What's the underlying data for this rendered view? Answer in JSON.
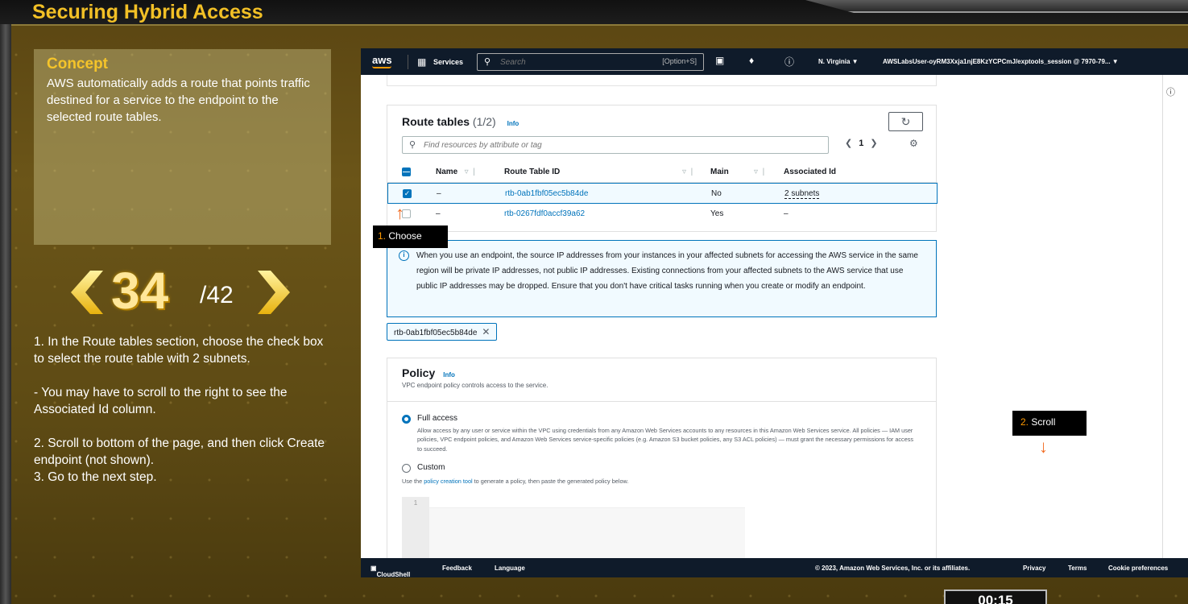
{
  "lesson": {
    "title": "Securing Hybrid Access",
    "concept_title": "Concept",
    "concept_body": "AWS automatically adds a route that points traffic destined for a service to the endpoint to the selected route tables.",
    "step_current": "34",
    "step_total": "/42",
    "instructions": [
      "1. In the Route tables section, choose the check box to select the route table with 2 subnets.",
      "- You may have to scroll to the right to see the Associated Id column.",
      "2. Scroll to bottom of the page, and then click Create endpoint (not shown).",
      "3. Go to the next step."
    ],
    "timer": "00:15"
  },
  "callouts": {
    "choose_num": "1.",
    "choose_text": " Choose",
    "scroll_num": "2.",
    "scroll_text": " Scroll"
  },
  "aws_nav": {
    "logo": "aws",
    "services": "Services",
    "search_placeholder": "Search",
    "search_shortcut": "[Option+S]",
    "region": "N. Virginia ▼",
    "user": "AWSLabsUser-oyRM3Xxja1njE8KzYCPCmJ/exptools_session @ 7970-79... ▼"
  },
  "route_tables": {
    "title": "Route tables",
    "count": "(1/2)",
    "info": "Info",
    "filter_placeholder": "Find resources by attribute or tag",
    "page": "1",
    "columns": [
      "Name",
      "Route Table ID",
      "Main",
      "Associated Id"
    ],
    "rows": [
      {
        "name": "–",
        "id": "rtb-0ab1fbf05ec5b84de",
        "main": "No",
        "assoc": "2 subnets",
        "selected": true
      },
      {
        "name": "–",
        "id": "rtb-0267fdf0accf39a62",
        "main": "Yes",
        "assoc": "–",
        "selected": false
      }
    ]
  },
  "alert_text": "When you use an endpoint, the source IP addresses from your instances in your affected subnets for accessing the AWS service in the same region will be private IP addresses, not public IP addresses. Existing connections from your affected subnets to the AWS service that use public IP addresses may be dropped. Ensure that you don't have critical tasks running when you create or modify an endpoint.",
  "selected_token": "rtb-0ab1fbf05ec5b84de",
  "policy": {
    "title": "Policy",
    "info": "Info",
    "description": "VPC endpoint policy controls access to the service.",
    "full_access_label": "Full access",
    "full_access_desc": "Allow access by any user or service within the VPC using credentials from any Amazon Web Services accounts to any resources in this Amazon Web Services service. All policies — IAM user policies, VPC endpoint policies, and Amazon Web Services service-specific policies (e.g. Amazon S3 bucket policies, any S3 ACL policies) — must grant the necessary permissions for access to succeed.",
    "custom_label": "Custom",
    "custom_desc_pre": "Use the ",
    "custom_desc_link": "policy creation tool",
    "custom_desc_post": " to generate a policy, then paste the generated policy below.",
    "editor_line": "1"
  },
  "aws_footer": {
    "cloudshell": "CloudShell",
    "feedback": "Feedback",
    "language": "Language",
    "copyright": "© 2023, Amazon Web Services, Inc. or its affiliates.",
    "privacy": "Privacy",
    "terms": "Terms",
    "cookies": "Cookie preferences"
  },
  "colors": {
    "accent_gold": "#f2c026",
    "aws_nav": "#0f1b2a",
    "aws_link": "#0073bb",
    "callout_arrow": "#f26c22"
  }
}
